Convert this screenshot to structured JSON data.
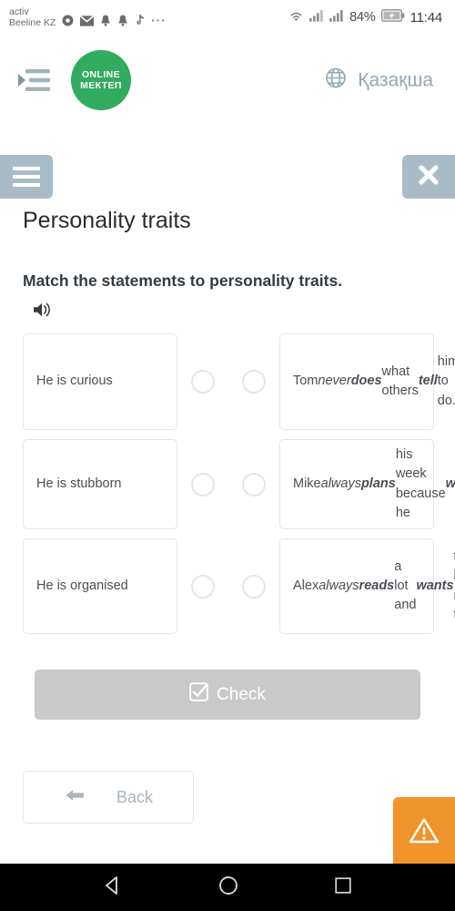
{
  "status_bar": {
    "carrier_line1": "activ",
    "carrier_line2": "Beeline KZ",
    "icons": [
      "chrome-icon",
      "mail-icon",
      "bell-icon",
      "bell-outline-icon",
      "tiktok-icon",
      "more-icon"
    ],
    "wifi_icon": "wifi-icon",
    "signal_icon_1": "signal-bars-icon",
    "signal_icon_2": "signal-bars-icon",
    "battery_percent": "84%",
    "battery_icon": "battery-charging-icon",
    "clock": "11:44"
  },
  "app_header": {
    "menu_toggle_icon": "menu-indent-icon",
    "logo_line1": "ONLINE",
    "logo_line2": "МЕКТЕП",
    "logo_color": "#30ab5f",
    "language_icon": "globe-icon",
    "language_label": "Қазақша"
  },
  "toolbar": {
    "menu_icon": "hamburger-icon",
    "close_icon": "close-icon",
    "button_color": "#a8bcc8"
  },
  "page": {
    "title": "Personality traits",
    "prompt": "Match the statements to personality traits.",
    "audio_icon": "speaker-icon"
  },
  "match": {
    "rows": [
      {
        "left_text": "He is curious",
        "right_html": "Tom <i>never</i> <b>does</b> what others <b>tell</b> him to do.",
        "left_dot": "connector-dot",
        "right_dot": "connector-dot"
      },
      {
        "left_text": "He is stubborn",
        "right_html": "Mike <i>always</i> <b>plans</b> his week because he <b>works</b> and <b>lives</b> in a big city.",
        "left_dot": "connector-dot",
        "right_dot": "connector-dot"
      },
      {
        "left_text": "He is organised",
        "right_html": "Alex <i>always</i> <b>reads</b> a lot and <b>wants</b> to know many things.",
        "left_dot": "connector-dot",
        "right_dot": "connector-dot"
      }
    ]
  },
  "actions": {
    "check_label": "Check",
    "check_icon": "check-square-icon",
    "check_color": "#c9c9c9",
    "back_label": "Back",
    "back_icon": "arrow-left-icon",
    "warning_icon": "warning-triangle-icon",
    "warning_color": "#f0932b"
  },
  "android_nav": {
    "back_icon": "nav-back-triangle-icon",
    "home_icon": "nav-home-circle-icon",
    "recents_icon": "nav-recents-square-icon"
  }
}
